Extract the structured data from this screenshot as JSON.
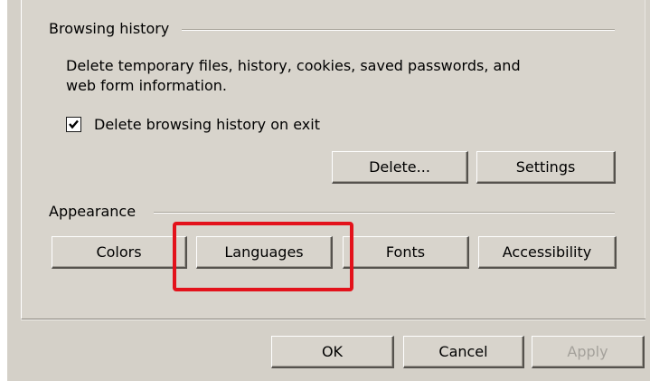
{
  "browsing_history": {
    "group_title": "Browsing history",
    "description_line1": "Delete temporary files, history, cookies, saved passwords, and",
    "description_line2": "web form information.",
    "checkbox_label": "Delete browsing history on exit",
    "checkbox_checked": true,
    "delete_button": "Delete...",
    "settings_button": "Settings"
  },
  "appearance": {
    "group_title": "Appearance",
    "buttons": [
      "Colors",
      "Languages",
      "Fonts",
      "Accessibility"
    ]
  },
  "dialog_buttons": {
    "ok": "OK",
    "cancel": "Cancel",
    "apply": "Apply",
    "apply_enabled": false
  },
  "highlight_color": "#e3121b"
}
